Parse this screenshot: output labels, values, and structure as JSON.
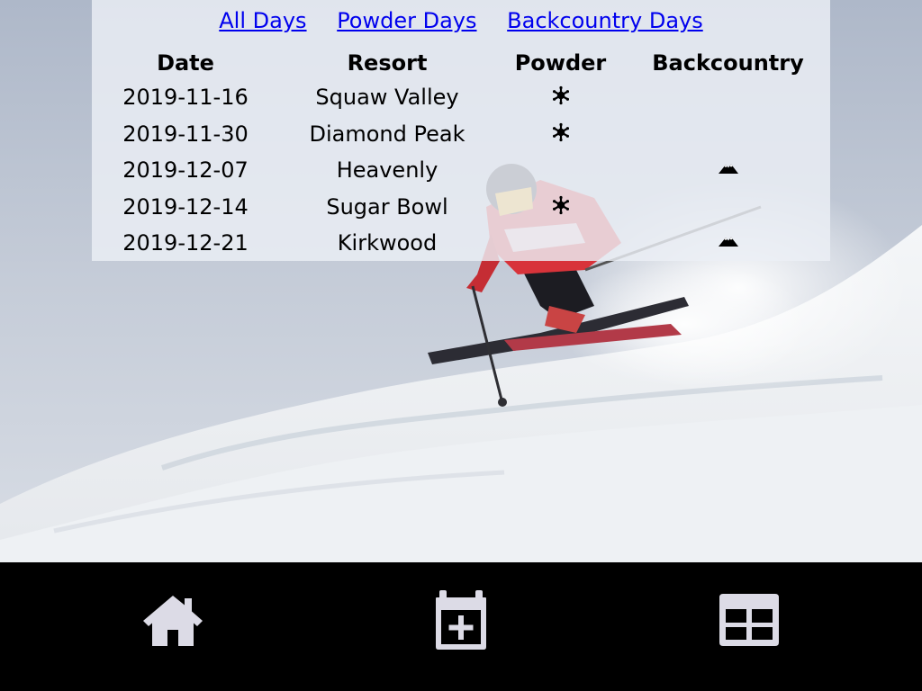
{
  "filters": {
    "all_days": "All Days",
    "powder_days": "Powder Days",
    "backcountry_days": "Backcountry Days"
  },
  "table": {
    "headers": {
      "date": "Date",
      "resort": "Resort",
      "powder": "Powder",
      "backcountry": "Backcountry"
    },
    "rows": [
      {
        "date": "2019-11-16",
        "resort": "Squaw Valley",
        "powder": true,
        "backcountry": false
      },
      {
        "date": "2019-11-30",
        "resort": "Diamond Peak",
        "powder": true,
        "backcountry": false
      },
      {
        "date": "2019-12-07",
        "resort": "Heavenly",
        "powder": false,
        "backcountry": true
      },
      {
        "date": "2019-12-14",
        "resort": "Sugar Bowl",
        "powder": true,
        "backcountry": false
      },
      {
        "date": "2019-12-21",
        "resort": "Kirkwood",
        "powder": false,
        "backcountry": true
      }
    ],
    "powder_icon": "snowflake-icon",
    "backcountry_icon": "mountain-icon"
  },
  "nav": {
    "items": [
      {
        "name": "home",
        "icon": "home-icon"
      },
      {
        "name": "add-day",
        "icon": "calendar-plus-icon"
      },
      {
        "name": "table",
        "icon": "table-icon"
      }
    ],
    "icon_color": "#dcdbe6"
  },
  "colors": {
    "link": "#0000ee",
    "panel": "#eceff5",
    "nav_bg": "#000000"
  }
}
